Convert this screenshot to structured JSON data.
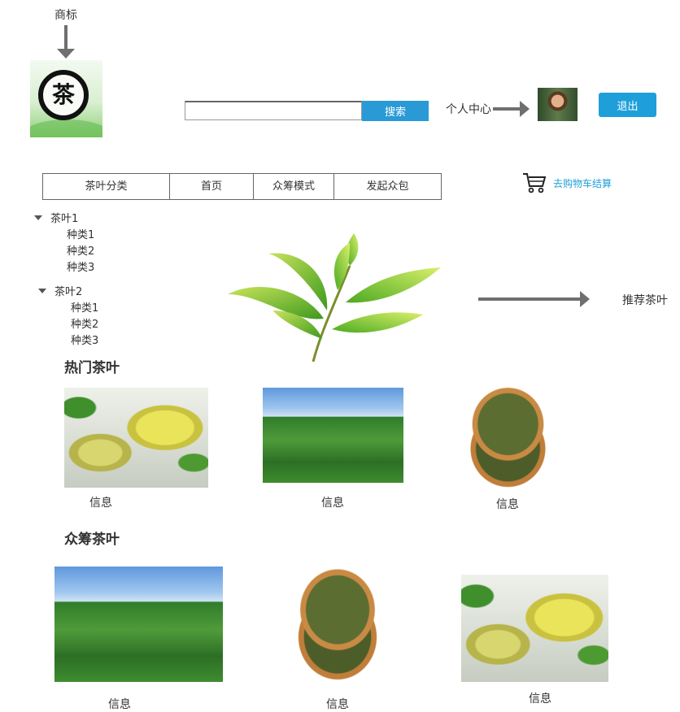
{
  "annotations": {
    "logo_note": "商标",
    "profile_note": "个人中心",
    "recommend_note": "推荐茶叶"
  },
  "logo": {
    "char": "茶",
    "icon": "tea-seal-logo"
  },
  "header": {
    "search_placeholder": "",
    "search_button": "搜索",
    "logout_button": "退出"
  },
  "nav": {
    "items": [
      {
        "label": "茶叶分类"
      },
      {
        "label": "首页"
      },
      {
        "label": "众筹模式"
      },
      {
        "label": "发起众包"
      }
    ]
  },
  "cart": {
    "label": "去购物车结算",
    "icon": "shopping-cart-icon"
  },
  "sidebar": {
    "categories": [
      {
        "label": "茶叶1",
        "children": [
          {
            "label": "种类1"
          },
          {
            "label": "种类2"
          },
          {
            "label": "种类3"
          }
        ]
      },
      {
        "label": "茶叶2",
        "children": [
          {
            "label": "种类1"
          },
          {
            "label": "种类2"
          },
          {
            "label": "种类3"
          }
        ]
      }
    ]
  },
  "hot": {
    "title": "热门茶叶",
    "items": [
      {
        "info": "信息"
      },
      {
        "info": "信息"
      },
      {
        "info": "信息"
      }
    ]
  },
  "crowd": {
    "title": "众筹茶叶",
    "items": [
      {
        "info": "信息"
      },
      {
        "info": "信息"
      },
      {
        "info": "信息"
      }
    ]
  },
  "colors": {
    "accent": "#1e9fd9",
    "search": "#2a9ad6",
    "arrow": "#6f6f6f",
    "border": "#666666"
  }
}
